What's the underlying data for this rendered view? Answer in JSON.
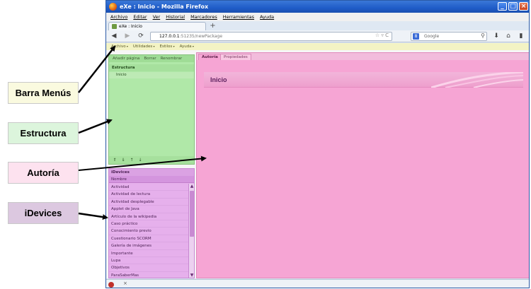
{
  "callouts": {
    "menu_bar": "Barra Menús",
    "structure": "Estructura",
    "authoring": "Autoría",
    "idevices": "iDevices"
  },
  "colors": {
    "menu_callout": "#fafadf",
    "structure_callout": "#dcf5dc",
    "authoring_callout": "#fde2ef",
    "idevices_callout": "#dcc8e0"
  },
  "browser": {
    "title": "eXe : Inicio - Mozilla Firefox",
    "menus": [
      "Archivo",
      "Editar",
      "Ver",
      "Historial",
      "Marcadores",
      "Herramientas",
      "Ayuda"
    ],
    "tab_label": "eXe : Inicio",
    "url_host": "127.0.0.1",
    "url_rest": ":51235/newPackage",
    "search_placeholder": "Google"
  },
  "app": {
    "menus": [
      "Archivo",
      "Utilidades",
      "Estilos",
      "Ayuda"
    ],
    "outline": {
      "tools": [
        "Añadir página",
        "Borrar",
        "Renombrar"
      ],
      "heading": "Estructura",
      "items": [
        "Inicio"
      ]
    },
    "idevices": {
      "title": "iDevices",
      "column": "Nombre",
      "items": [
        "Actividad",
        "Actividad de lectura",
        "Actividad desplegable",
        "Applet de Java",
        "Artículo de la wikipedia",
        "Caso práctico",
        "Conocimiento previo",
        "Cuestionario SCORM",
        "Galería de imágenes",
        "Importante",
        "Lupa",
        "Objetivos",
        "ParaSaberMas"
      ]
    },
    "authoring": {
      "tabs": [
        "Autoría",
        "Propiedades"
      ],
      "node_title": "Inicio"
    }
  }
}
